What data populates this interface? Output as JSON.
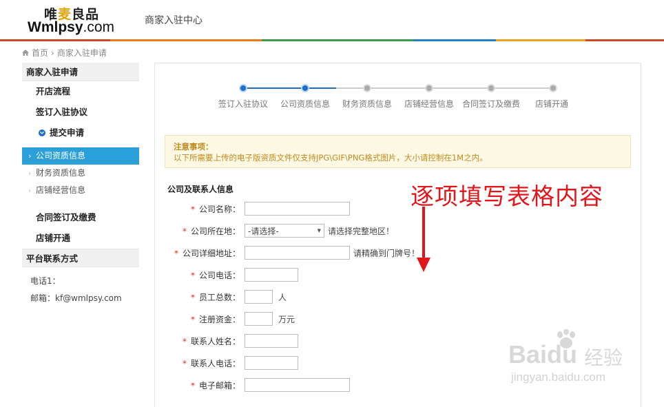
{
  "brand": {
    "name_cn_prefix": "唯",
    "name_cn_highlight": "麦",
    "name_cn_suffix": "良品",
    "name_en": "Wmlpsy",
    "name_en_suffix": ".com"
  },
  "header": {
    "title": "商家入驻中心"
  },
  "header_stripe_colors": [
    "#c94b2a",
    "#e87a1f",
    "#3a9b4a",
    "#2a7fc4",
    "#e8a21f",
    "#c94b2a"
  ],
  "breadcrumb": {
    "home": "首页",
    "separator": "›",
    "current": "商家入驻申请"
  },
  "sidebar": {
    "section1_title": "商家入驻申请",
    "items": [
      "开店流程",
      "签订入驻协议"
    ],
    "submit_label": "提交申请",
    "sub_items": [
      {
        "label": "公司资质信息",
        "active": true
      },
      {
        "label": "财务资质信息",
        "active": false
      },
      {
        "label": "店铺经营信息",
        "active": false
      }
    ],
    "items_after": [
      "合同签订及缴费",
      "店铺开通"
    ],
    "section2_title": "平台联系方式",
    "phone": "电话1：",
    "email": "邮箱：kf@wmlpsy.com"
  },
  "steps": [
    {
      "label": "签订入驻协议",
      "done": true
    },
    {
      "label": "公司资质信息",
      "done": true
    },
    {
      "label": "财务资质信息",
      "done": false
    },
    {
      "label": "店铺经营信息",
      "done": false
    },
    {
      "label": "合同签订及缴费",
      "done": false
    },
    {
      "label": "店铺开通",
      "done": false
    }
  ],
  "notice": {
    "title": "注意事项：",
    "text": "以下所需要上传的电子版资质文件仅支持JPG\\GIF\\PNG格式图片，大小请控制在1M之内。"
  },
  "form": {
    "section_title": "公司及联系人信息",
    "required_mark": "*",
    "fields": [
      {
        "label": "公司名称："
      },
      {
        "label": "公司所在地：",
        "select_value": "-请选择-",
        "hint": "请选择完整地区！"
      },
      {
        "label": "公司详细地址：",
        "hint": "请精确到门牌号！"
      },
      {
        "label": "公司电话："
      },
      {
        "label": "员工总数：",
        "unit": "人"
      },
      {
        "label": "注册资金：",
        "unit": "万元"
      },
      {
        "label": "联系人姓名："
      },
      {
        "label": "联系人电话："
      },
      {
        "label": "电子邮箱："
      }
    ]
  },
  "annotation": {
    "text": "逐项填写表格内容",
    "color": "#e0161a"
  },
  "watermark": {
    "logo": "Bai",
    "logo2": "du",
    "cn": "经验",
    "url": "jingyan.baidu.com"
  },
  "colors": {
    "accent": "#1b6fc4",
    "active_bg": "#2a9fd8",
    "required": "#d9261c",
    "notice_text": "#c08a1e"
  }
}
